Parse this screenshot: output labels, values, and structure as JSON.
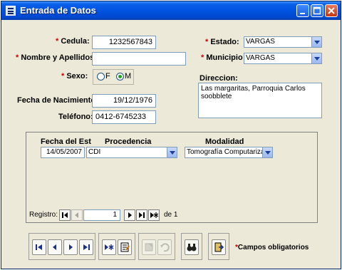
{
  "window": {
    "title": "Entrada de Datos"
  },
  "form": {
    "cedula": {
      "label": "Cedula:",
      "value": "1232567843",
      "required": "*"
    },
    "nombre": {
      "label": "Nombre y Apellidos:",
      "value": "",
      "required": "*"
    },
    "sexo": {
      "label": "Sexo:",
      "required": "*",
      "options": [
        "F",
        "M"
      ],
      "selected": "M"
    },
    "fecha_nacimiento": {
      "label": "Fecha de Nacimiento:",
      "value": "19/12/1976"
    },
    "telefono": {
      "label": "Teléfono:",
      "value": "0412-6745233"
    },
    "estado": {
      "label": "Estado:",
      "value": "VARGAS",
      "required": "*"
    },
    "municipio": {
      "label": "Municipio",
      "value": "VARGAS",
      "required": "*"
    },
    "direccion": {
      "label": "Direccion:",
      "value": "Las margaritas, Parroquia Carlos soobblete"
    }
  },
  "subform": {
    "columns": [
      "Fecha del Est",
      "Procedencia",
      "Modalidad"
    ],
    "rows": [
      {
        "fecha": "14/05/2007",
        "procedencia": "CDI",
        "modalidad": "Tomografía Computarizada"
      }
    ],
    "navigation": {
      "record_label": "Registro:",
      "current": "1",
      "of_label": "de 1"
    }
  },
  "footer": {
    "required_note": "Campos obligatorios",
    "required_mark": "*"
  },
  "colors": {
    "titlebar": "#0053e1",
    "window_bg": "#ece9d8",
    "required": "#d00000"
  }
}
